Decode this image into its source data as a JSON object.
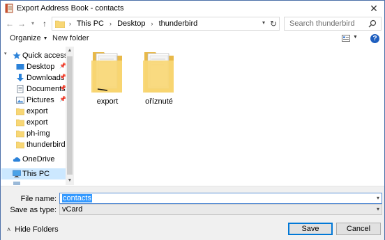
{
  "window": {
    "title": "Export Address Book - contacts"
  },
  "nav": {
    "breadcrumbs": [
      "This PC",
      "Desktop",
      "thunderbird"
    ],
    "search_placeholder": "Search thunderbird"
  },
  "toolbar": {
    "organize_label": "Organize",
    "new_folder_label": "New folder"
  },
  "sidebar": {
    "quick_access": "Quick access",
    "items": [
      {
        "label": "Desktop",
        "icon": "desktop-icon",
        "pinned": true
      },
      {
        "label": "Downloads",
        "icon": "download-icon",
        "pinned": true
      },
      {
        "label": "Documents",
        "icon": "documents-icon",
        "pinned": true
      },
      {
        "label": "Pictures",
        "icon": "pictures-icon",
        "pinned": true
      },
      {
        "label": "export",
        "icon": "folder-icon",
        "pinned": false
      },
      {
        "label": "export",
        "icon": "folder-icon",
        "pinned": false
      },
      {
        "label": "ph-img",
        "icon": "folder-icon",
        "pinned": false
      },
      {
        "label": "thunderbird",
        "icon": "folder-icon",
        "pinned": false
      }
    ],
    "onedrive": "OneDrive",
    "this_pc": "This PC"
  },
  "files": [
    {
      "name": "export",
      "icon": "folder-icon"
    },
    {
      "name": "oříznuté",
      "icon": "folder-icon"
    }
  ],
  "form": {
    "file_name_label": "File name:",
    "file_name_value": "contacts",
    "save_type_label": "Save as type:",
    "save_type_value": "vCard"
  },
  "footer": {
    "hide_folders_label": "Hide Folders",
    "save_label": "Save",
    "cancel_label": "Cancel"
  },
  "colors": {
    "accent": "#0078d7",
    "selection": "#cce8ff",
    "folder": "#f8d775"
  }
}
